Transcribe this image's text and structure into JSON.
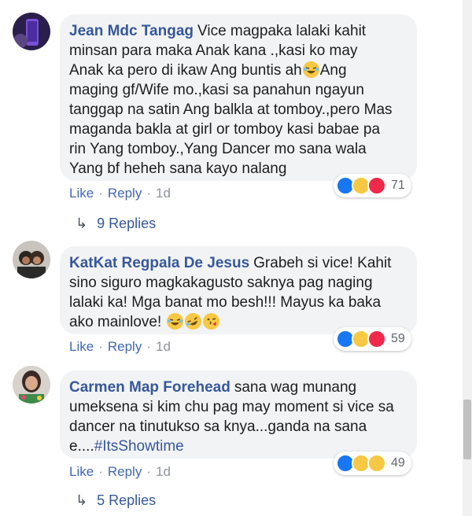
{
  "comments": [
    {
      "author": "Jean Mdc Tangag",
      "text_lines": [
        "Vice magpaka lalaki kahit",
        "minsan para maka Anak kana .,kasi ko may",
        "Anak ka pero di ikaw Ang buntis ah",
        "Ang",
        "maging gf/Wife mo.,kasi sa panahun ngayun",
        "tanggap na satin Ang balkla at tomboy.,pero Mas",
        "maganda bakla at girl or tomboy kasi babae pa",
        "rin Yang tomboy.,Yang Dancer mo sana wala",
        "Yang bf heheh sana kayo nalang"
      ],
      "actions": {
        "like": "Like",
        "reply": "Reply",
        "time": "1d"
      },
      "reaction_icons": [
        "like-icon",
        "haha-icon",
        "love-icon"
      ],
      "reaction_count": "71",
      "replies_label": "9 Replies"
    },
    {
      "author": "KatKat Regpala De Jesus",
      "text_lines": [
        "Grabeh si vice! Kahit",
        "sino siguro magkakagusto saknya pag naging",
        "lalaki ka! Mga banat mo besh!!! Mayus ka baka",
        "ako mainlove!"
      ],
      "actions": {
        "like": "Like",
        "reply": "Reply",
        "time": "1d"
      },
      "reaction_icons": [
        "like-icon",
        "haha-icon",
        "love-icon"
      ],
      "reaction_count": "59"
    },
    {
      "author": "Carmen Map Forehead",
      "text_lines": [
        "sana wag munang",
        "umeksena si kim chu pag may moment si vice sa",
        "dancer na tinutukso sa knya...ganda na sana",
        "e...."
      ],
      "hashtag": "#ItsShowtime",
      "actions": {
        "like": "Like",
        "reply": "Reply",
        "time": "1d"
      },
      "reaction_icons": [
        "like-icon",
        "haha-icon",
        "wow-icon"
      ],
      "reaction_count": "49",
      "replies_label": "5 Replies"
    }
  ],
  "colors": {
    "link": "#365899",
    "action": "#4267b2",
    "bubble": "#f2f3f5"
  }
}
